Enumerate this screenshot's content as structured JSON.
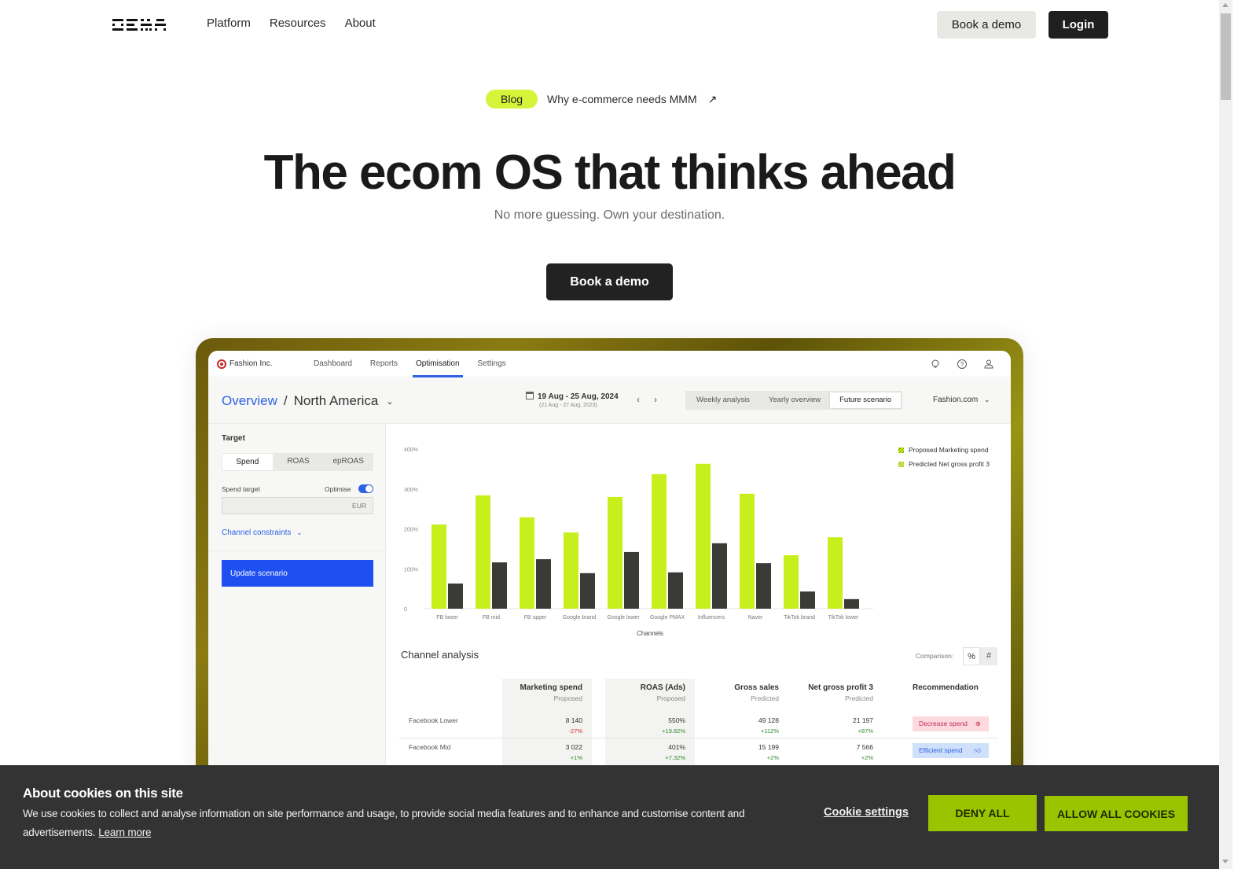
{
  "nav": {
    "logo_text": "DEMA",
    "links": [
      "Platform",
      "Resources",
      "About"
    ],
    "book_demo": "Book a demo",
    "login": "Login"
  },
  "announcement": {
    "badge": "Blog",
    "text": "Why e-commerce needs MMM",
    "arrow": "↗"
  },
  "hero": {
    "title": "The ecom OS that thinks ahead",
    "subtitle": "No more guessing. Own your destination.",
    "cta": "Book a demo"
  },
  "app": {
    "brand": "Fashion Inc.",
    "tabs": [
      "Dashboard",
      "Reports",
      "Optimisation",
      "Settings"
    ],
    "active_tab": "Optimisation",
    "icons": [
      "lightbulb-icon",
      "help-icon",
      "user-icon"
    ],
    "breadcrumb": {
      "root": "Overview",
      "separator": "/",
      "current": "North America"
    },
    "date_range": "19 Aug - 25 Aug, 2024",
    "date_compare": "(21 Aug - 27 Aug, 2023)",
    "date_prev": "‹",
    "date_next": "›",
    "views": [
      "Weekly analysis",
      "Yearly overview",
      "Future scenario"
    ],
    "active_view": "Future scenario",
    "store": "Fashion.com",
    "sidebar": {
      "title": "Target",
      "target_options": [
        "Spend",
        "ROAS",
        "epROAS"
      ],
      "active_target": "Spend",
      "spend_target_label": "Spend target",
      "optimise_label": "Optimise",
      "optimise_on": true,
      "currency": "EUR",
      "constraints_label": "Channel constraints",
      "update_button": "Update scenario"
    },
    "table": {
      "title": "Channel analysis",
      "comparison_label": "Comparison:",
      "comparison_options": [
        "%",
        "#"
      ],
      "columns": [
        {
          "title": "Marketing spend",
          "sub": "Proposed"
        },
        {
          "title": "ROAS (Ads)",
          "sub": "Proposed"
        },
        {
          "title": "Gross sales",
          "sub": "Predicted"
        },
        {
          "title": "Net gross profit 3",
          "sub": "Predicted"
        },
        {
          "title": "Recommendation",
          "sub": ""
        }
      ],
      "rows": [
        {
          "channel": "Facebook Lower",
          "spend": "8 140",
          "spend_delta": "-27%",
          "roas": "550%",
          "roas_delta": "+19.82%",
          "gross": "49 128",
          "gross_delta": "+112%",
          "ngp": "21 197",
          "ngp_delta": "+87%",
          "recommendation": "Decrease spend"
        },
        {
          "channel": "Facebook Mid",
          "spend": "3 022",
          "spend_delta": "+1%",
          "roas": "401%",
          "roas_delta": "+7.32%",
          "gross": "15 199",
          "gross_delta": "+2%",
          "ngp": "7 566",
          "ngp_delta": "+2%",
          "recommendation": "Efficient spend"
        }
      ]
    }
  },
  "chart_data": {
    "type": "bar",
    "title": "",
    "xlabel": "Channels",
    "ylabel": "",
    "ylim": [
      0,
      400
    ],
    "yticks": [
      "0",
      "100%",
      "200%",
      "300%",
      "400%"
    ],
    "grid": false,
    "legend_position": "top-right",
    "categories": [
      "FB lower",
      "FB mid",
      "FB upper",
      "Google brand",
      "Google lower",
      "Google PMAX",
      "Influencers",
      "Naver",
      "TikTok brand",
      "TikTok lower"
    ],
    "series": [
      {
        "name": "Proposed Marketing spend",
        "color": "#c7ef1c",
        "values": [
          211,
          284,
          229,
          191,
          280,
          337,
          363,
          288,
          134,
          179
        ]
      },
      {
        "name": "Predicted Net gross profit 3",
        "color": "#3a3a37",
        "values": [
          63,
          116,
          124,
          89,
          142,
          91,
          164,
          114,
          43,
          24
        ]
      }
    ]
  },
  "cookie": {
    "title": "About cookies on this site",
    "text": "We use cookies to collect and analyse information on site performance and usage, to provide social media features and to enhance and customise content and advertisements.",
    "learn_more": "Learn more",
    "settings": "Cookie settings",
    "deny": "DENY ALL",
    "allow": "ALLOW ALL COOKIES"
  },
  "colors": {
    "accent_lime": "#d6f53a",
    "bar_lime": "#c7ef1c",
    "bar_dark": "#3a3a37",
    "app_blue": "#2f62e3",
    "cookie_button": "#9bc400",
    "cookie_bg": "#333333"
  }
}
